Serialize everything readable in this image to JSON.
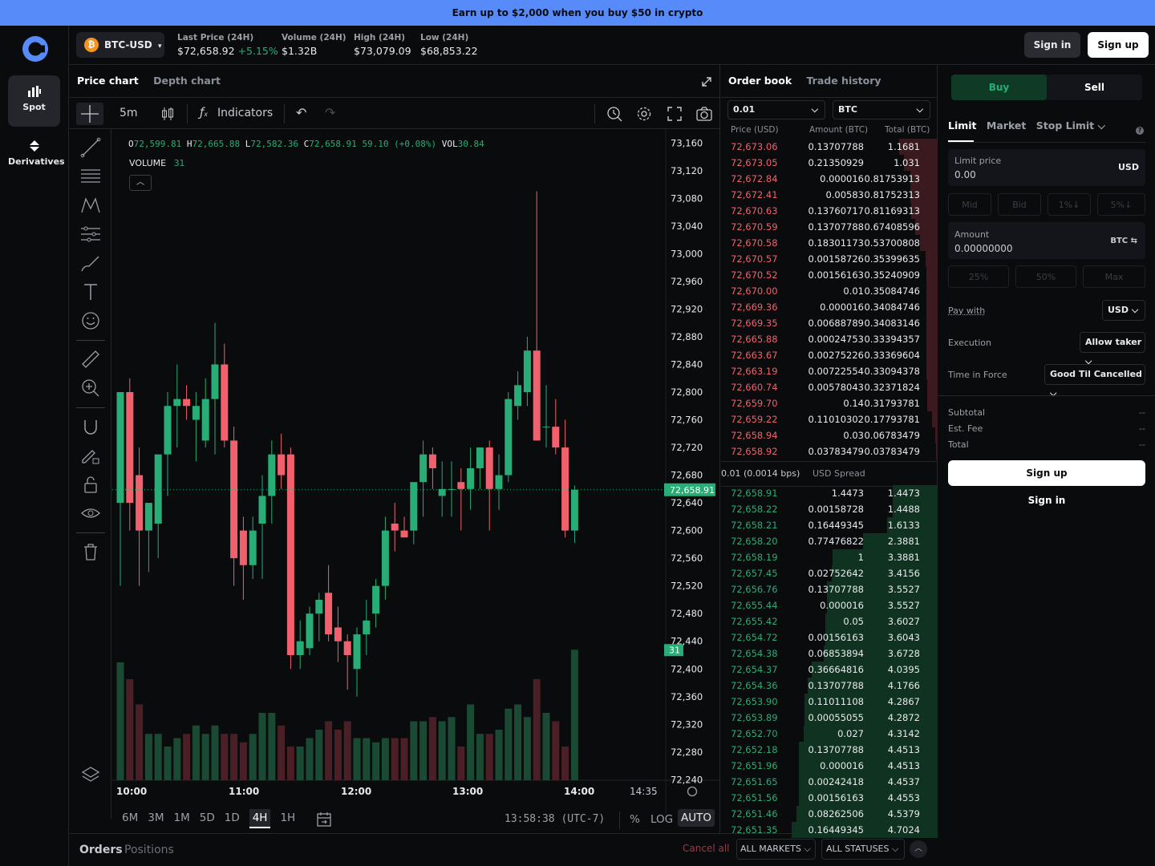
{
  "banner": {
    "text": "Earn up to $2,000 when you buy $50 in crypto"
  },
  "nav": {
    "spot": "Spot",
    "derivatives": "Derivatives"
  },
  "header": {
    "pair": "BTC-USD",
    "coin_symbol": "₿",
    "last_price_label": "Last Price (24H)",
    "last_price": "$72,658.92",
    "last_change": "+5.15%",
    "volume_label": "Volume (24H)",
    "volume": "$1.32B",
    "high_label": "High (24H)",
    "high": "$73,079.09",
    "low_label": "Low (24H)",
    "low": "$68,853.22",
    "sign_in": "Sign in",
    "sign_up": "Sign up"
  },
  "chart_tabs": {
    "price": "Price chart",
    "depth": "Depth chart"
  },
  "chart_toolbar": {
    "interval": "5m",
    "indicators": "Indicators"
  },
  "legend": {
    "o_label": "O",
    "o": "72,599.81",
    "h_label": "H",
    "h": "72,665.88",
    "l_label": "L",
    "l": "72,582.36",
    "c_label": "C",
    "c": "72,658.91",
    "change": "59.10 (+0.08%)",
    "vol_label": "VOL",
    "vol": "30.84",
    "volume_label": "VOLUME",
    "volume_value": "31"
  },
  "price_axis": [
    "73,160",
    "73,120",
    "73,080",
    "73,040",
    "73,000",
    "72,960",
    "72,920",
    "72,880",
    "72,840",
    "72,800",
    "72,760",
    "72,720",
    "72,680",
    "72,640",
    "72,600",
    "72,560",
    "72,520",
    "72,480",
    "72,440",
    "72,400",
    "72,360",
    "72,320",
    "72,280",
    "72,240"
  ],
  "current_price_tag": "72,658.91",
  "volume_tag": "31",
  "time_axis": [
    "10:00",
    "11:00",
    "12:00",
    "13:00",
    "14:00",
    "14:35"
  ],
  "ranges": [
    "6M",
    "3M",
    "1M",
    "5D",
    "1D",
    "4H",
    "1H"
  ],
  "active_range": "4H",
  "clock": "13:58:38 (UTC-7)",
  "scale_opts": {
    "pct": "%",
    "log": "LOG",
    "auto": "AUTO"
  },
  "orders_bar": {
    "orders": "Orders",
    "positions": "Positions",
    "cancel_all": "Cancel all",
    "markets": "ALL MARKETS",
    "statuses": "ALL STATUSES"
  },
  "orderbook": {
    "tab_book": "Order book",
    "tab_history": "Trade history",
    "aggregation": "0.01",
    "unit": "BTC",
    "col_price": "Price (USD)",
    "col_amount": "Amount (BTC)",
    "col_total": "Total (BTC)",
    "spread_value": "0.01 (0.0014 bps)",
    "spread_label": "USD Spread",
    "asks": [
      [
        "72,673.06",
        "0.13707788",
        "1.1681"
      ],
      [
        "72,673.05",
        "0.21350929",
        "1.031"
      ],
      [
        "72,672.84",
        "0.000016",
        "0.81753913"
      ],
      [
        "72,672.41",
        "0.00583",
        "0.81752313"
      ],
      [
        "72,670.63",
        "0.13760717",
        "0.81169313"
      ],
      [
        "72,670.59",
        "0.13707788",
        "0.67408596"
      ],
      [
        "72,670.58",
        "0.18301173",
        "0.53700808"
      ],
      [
        "72,670.57",
        "0.00158726",
        "0.35399635"
      ],
      [
        "72,670.52",
        "0.00156163",
        "0.35240909"
      ],
      [
        "72,670.00",
        "0.01",
        "0.35084746"
      ],
      [
        "72,669.36",
        "0.000016",
        "0.34084746"
      ],
      [
        "72,669.35",
        "0.00688789",
        "0.34083146"
      ],
      [
        "72,665.88",
        "0.00024753",
        "0.33394357"
      ],
      [
        "72,663.67",
        "0.00275226",
        "0.33369604"
      ],
      [
        "72,663.19",
        "0.00722554",
        "0.33094378"
      ],
      [
        "72,660.74",
        "0.00578043",
        "0.32371824"
      ],
      [
        "72,659.70",
        "0.14",
        "0.31793781"
      ],
      [
        "72,659.22",
        "0.11010302",
        "0.17793781"
      ],
      [
        "72,658.94",
        "0.03",
        "0.06783479"
      ],
      [
        "72,658.92",
        "0.03783479",
        "0.03783479"
      ]
    ],
    "bids": [
      [
        "72,658.91",
        "1.4473",
        "1.4473"
      ],
      [
        "72,658.22",
        "0.00158728",
        "1.4488"
      ],
      [
        "72,658.21",
        "0.16449345",
        "1.6133"
      ],
      [
        "72,658.20",
        "0.77476822",
        "2.3881"
      ],
      [
        "72,658.19",
        "1",
        "3.3881"
      ],
      [
        "72,657.45",
        "0.02752642",
        "3.4156"
      ],
      [
        "72,656.76",
        "0.13707788",
        "3.5527"
      ],
      [
        "72,655.44",
        "0.000016",
        "3.5527"
      ],
      [
        "72,655.42",
        "0.05",
        "3.6027"
      ],
      [
        "72,654.72",
        "0.00156163",
        "3.6043"
      ],
      [
        "72,654.38",
        "0.06853894",
        "3.6728"
      ],
      [
        "72,654.37",
        "0.36664816",
        "4.0395"
      ],
      [
        "72,654.36",
        "0.13707788",
        "4.1766"
      ],
      [
        "72,653.90",
        "0.11011108",
        "4.2867"
      ],
      [
        "72,653.89",
        "0.00055055",
        "4.2872"
      ],
      [
        "72,652.70",
        "0.027",
        "4.3142"
      ],
      [
        "72,652.18",
        "0.13707788",
        "4.4513"
      ],
      [
        "72,651.96",
        "0.000016",
        "4.4513"
      ],
      [
        "72,651.65",
        "0.00242418",
        "4.4537"
      ],
      [
        "72,651.56",
        "0.00156163",
        "4.4553"
      ],
      [
        "72,651.46",
        "0.08262506",
        "4.5379"
      ],
      [
        "72,651.35",
        "0.16449345",
        "4.7024"
      ]
    ]
  },
  "trade": {
    "buy": "Buy",
    "sell": "Sell",
    "order_types": [
      "Limit",
      "Market",
      "Stop Limit"
    ],
    "limit_price_label": "Limit price",
    "limit_price": "0.00",
    "limit_unit": "USD",
    "quick_prices": [
      "Mid",
      "Bid",
      "1%↓",
      "5%↓"
    ],
    "amount_label": "Amount",
    "amount": "0.00000000",
    "amount_unit": "BTC ⇆",
    "pcts": [
      "25%",
      "50%",
      "Max"
    ],
    "pay_with_label": "Pay with",
    "pay_with": "USD",
    "execution_label": "Execution",
    "execution": "Allow taker",
    "tif_label": "Time in Force",
    "tif": "Good Til Cancelled",
    "subtotal_label": "Subtotal",
    "subtotal": "--",
    "fee_label": "Est. Fee",
    "fee": "--",
    "total_label": "Total",
    "total": "--",
    "sign_up": "Sign up",
    "sign_in": "Sign in"
  },
  "colors": {
    "up": "#27ad75",
    "down": "#f0616d",
    "accent": "#578bfa",
    "bg": "#0a0b0d"
  },
  "chart_data": {
    "type": "candlestick",
    "interval": "5m",
    "ylim": [
      72230,
      73180
    ],
    "candles": [
      {
        "o": 72640,
        "h": 72800,
        "l": 72520,
        "c": 72800
      },
      {
        "o": 72800,
        "h": 72820,
        "l": 72600,
        "c": 72640
      },
      {
        "o": 72680,
        "h": 72720,
        "l": 72520,
        "c": 72600
      },
      {
        "o": 72600,
        "h": 72640,
        "l": 72540,
        "c": 72640
      },
      {
        "o": 72610,
        "h": 72700,
        "l": 72560,
        "c": 72710
      },
      {
        "o": 72710,
        "h": 72800,
        "l": 72650,
        "c": 72780
      },
      {
        "o": 72780,
        "h": 72840,
        "l": 72720,
        "c": 72790
      },
      {
        "o": 72790,
        "h": 72810,
        "l": 72760,
        "c": 72780
      },
      {
        "o": 72760,
        "h": 72800,
        "l": 72700,
        "c": 72780
      },
      {
        "o": 72730,
        "h": 72820,
        "l": 72720,
        "c": 72790
      },
      {
        "o": 72790,
        "h": 72900,
        "l": 72710,
        "c": 72840
      },
      {
        "o": 72840,
        "h": 72870,
        "l": 72720,
        "c": 72730
      },
      {
        "o": 72730,
        "h": 72750,
        "l": 72520,
        "c": 72560
      },
      {
        "o": 72600,
        "h": 72620,
        "l": 72500,
        "c": 72550
      },
      {
        "o": 72550,
        "h": 72620,
        "l": 72530,
        "c": 72600
      },
      {
        "o": 72610,
        "h": 72680,
        "l": 72530,
        "c": 72650
      },
      {
        "o": 72650,
        "h": 72730,
        "l": 72610,
        "c": 72710
      },
      {
        "o": 72710,
        "h": 72740,
        "l": 72660,
        "c": 72680
      },
      {
        "o": 72710,
        "h": 72720,
        "l": 72400,
        "c": 72420
      },
      {
        "o": 72420,
        "h": 72470,
        "l": 72400,
        "c": 72440
      },
      {
        "o": 72430,
        "h": 72490,
        "l": 72420,
        "c": 72480
      },
      {
        "o": 72480,
        "h": 72510,
        "l": 72440,
        "c": 72500
      },
      {
        "o": 72510,
        "h": 72550,
        "l": 72440,
        "c": 72450
      },
      {
        "o": 72460,
        "h": 72490,
        "l": 72410,
        "c": 72440
      },
      {
        "o": 72440,
        "h": 72450,
        "l": 72370,
        "c": 72420
      },
      {
        "o": 72400,
        "h": 72460,
        "l": 72360,
        "c": 72450
      },
      {
        "o": 72450,
        "h": 72500,
        "l": 72420,
        "c": 72470
      },
      {
        "o": 72480,
        "h": 72530,
        "l": 72460,
        "c": 72520
      },
      {
        "o": 72520,
        "h": 72620,
        "l": 72500,
        "c": 72600
      },
      {
        "o": 72610,
        "h": 72640,
        "l": 72570,
        "c": 72600
      },
      {
        "o": 72600,
        "h": 72620,
        "l": 72590,
        "c": 72590
      },
      {
        "o": 72600,
        "h": 72670,
        "l": 72580,
        "c": 72670
      },
      {
        "o": 72670,
        "h": 72730,
        "l": 72620,
        "c": 72710
      },
      {
        "o": 72710,
        "h": 72720,
        "l": 72660,
        "c": 72690
      },
      {
        "o": 72650,
        "h": 72700,
        "l": 72620,
        "c": 72660
      },
      {
        "o": 72660,
        "h": 72700,
        "l": 72620,
        "c": 72660
      },
      {
        "o": 72670,
        "h": 72690,
        "l": 72600,
        "c": 72660
      },
      {
        "o": 72660,
        "h": 72720,
        "l": 72630,
        "c": 72690
      },
      {
        "o": 72690,
        "h": 72720,
        "l": 72660,
        "c": 72720
      },
      {
        "o": 72720,
        "h": 72730,
        "l": 72600,
        "c": 72660
      },
      {
        "o": 72660,
        "h": 72710,
        "l": 72630,
        "c": 72680
      },
      {
        "o": 72680,
        "h": 72800,
        "l": 72670,
        "c": 72790
      },
      {
        "o": 72780,
        "h": 72830,
        "l": 72760,
        "c": 72810
      },
      {
        "o": 72800,
        "h": 72880,
        "l": 72780,
        "c": 72860
      },
      {
        "o": 72860,
        "h": 73090,
        "l": 72800,
        "c": 72730
      },
      {
        "o": 72750,
        "h": 72810,
        "l": 72720,
        "c": 72750
      },
      {
        "o": 72750,
        "h": 72790,
        "l": 72710,
        "c": 72720
      },
      {
        "o": 72720,
        "h": 72760,
        "l": 72590,
        "c": 72600
      },
      {
        "o": 72600,
        "h": 72665,
        "l": 72582,
        "c": 72659
      }
    ],
    "volume": [
      28,
      24,
      18,
      11,
      11,
      8,
      10,
      11,
      13,
      11,
      13,
      11,
      11,
      9,
      11,
      16,
      16,
      13,
      8,
      8,
      10,
      12,
      14,
      12,
      14,
      10,
      10,
      9,
      10,
      10,
      10,
      14,
      14,
      15,
      14,
      15,
      8,
      18,
      11,
      11,
      12,
      17,
      18,
      15,
      24,
      16,
      14,
      8,
      31
    ],
    "volume_max": 40,
    "current_price": 72658.91
  }
}
